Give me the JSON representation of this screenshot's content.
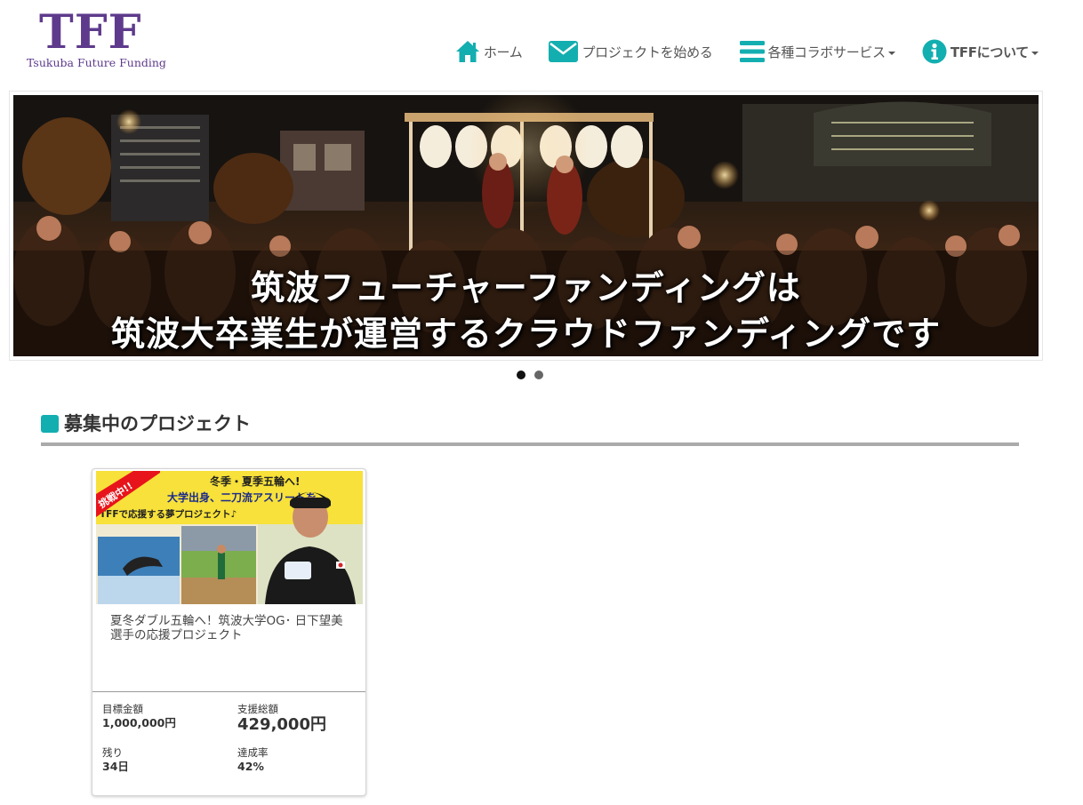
{
  "brand": {
    "logo_text": "TFF",
    "logo_subtitle": "Tsukuba Future Funding",
    "logo_color": "#5e3a8c"
  },
  "nav": {
    "accent_color": "#13aeb0",
    "items": [
      {
        "label": "ホーム",
        "icon": "home-icon"
      },
      {
        "label": "プロジェクトを始める",
        "icon": "envelope-icon"
      },
      {
        "label": "各種コラボサービス",
        "icon": "list-icon",
        "dropdown": true
      },
      {
        "label": "TFFについて",
        "icon": "info-icon",
        "dropdown": true
      }
    ]
  },
  "hero": {
    "line1": "筑波フューチャーファンディングは",
    "line2": "筑波大卒業生が運営するクラウドファンディングです",
    "slide_count": 2,
    "active_slide": 1,
    "dot_colors": {
      "active": "#111111",
      "inactive": "#666666"
    }
  },
  "section": {
    "title": "募集中のプロジェクト",
    "marker_color": "#13aeb0"
  },
  "project": {
    "badge": "挑戦中!!",
    "banner_line1": "冬季・夏季五輪へ!",
    "banner_line2": "大学出身、二刀流アスリートを",
    "banner_line3": "TFFで応援する夢プロジェクト♪",
    "title": "夏冬ダブル五輪へ！筑波大学OG･ 日下望美選手の応援プロジェクト",
    "target_label": "目標金額",
    "target_value": "1,000,000円",
    "raised_label": "支援総額",
    "raised_value": "429,000円",
    "remaining_label": "残り",
    "remaining_value": "34日",
    "rate_label": "達成率",
    "rate_value": "42%",
    "progress_fraction": 0.42
  }
}
